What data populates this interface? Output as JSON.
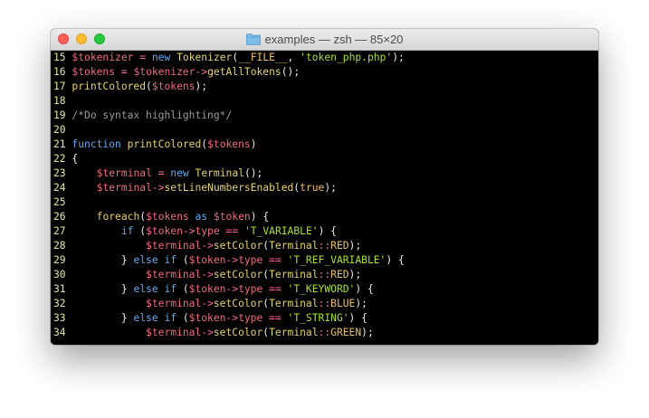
{
  "window": {
    "title": "examples — zsh — 85×20",
    "folder_icon": "folder-icon",
    "traffic_lights": [
      "close",
      "minimize",
      "maximize"
    ]
  },
  "colors": {
    "background": "#000000",
    "line_number": "#e6e6a0",
    "variable": "#f06a7c",
    "keyword": "#62a9f5",
    "function": "#e6d26e",
    "string": "#a6e22e",
    "comment": "#9a9a9a",
    "operator": "#ff6e9c",
    "plain": "#eaeaea",
    "constant": "#e8c06a"
  },
  "code_lines": [
    {
      "n": "15",
      "tokens": [
        [
          "var",
          "$tokenizer"
        ],
        [
          "p",
          " "
        ],
        [
          "op",
          "="
        ],
        [
          "p",
          " "
        ],
        [
          "kw",
          "new"
        ],
        [
          "p",
          " "
        ],
        [
          "fn",
          "Tokenizer"
        ],
        [
          "p",
          "("
        ],
        [
          "const",
          "__FILE__"
        ],
        [
          "p",
          ", "
        ],
        [
          "str",
          "'token_php.php'"
        ],
        [
          "p",
          ");"
        ]
      ]
    },
    {
      "n": "16",
      "tokens": [
        [
          "var",
          "$tokens"
        ],
        [
          "p",
          " "
        ],
        [
          "op",
          "="
        ],
        [
          "p",
          " "
        ],
        [
          "var",
          "$tokenizer"
        ],
        [
          "op",
          "->"
        ],
        [
          "fn",
          "getAllTokens"
        ],
        [
          "p",
          "();"
        ]
      ]
    },
    {
      "n": "17",
      "tokens": [
        [
          "fn",
          "printColored"
        ],
        [
          "p",
          "("
        ],
        [
          "var",
          "$tokens"
        ],
        [
          "p",
          ");"
        ]
      ]
    },
    {
      "n": "18",
      "tokens": []
    },
    {
      "n": "19",
      "tokens": [
        [
          "com",
          "/*Do syntax highlighting*/"
        ]
      ]
    },
    {
      "n": "20",
      "tokens": []
    },
    {
      "n": "21",
      "tokens": [
        [
          "kw",
          "function"
        ],
        [
          "p",
          " "
        ],
        [
          "fn",
          "printColored"
        ],
        [
          "p",
          "("
        ],
        [
          "var",
          "$tokens"
        ],
        [
          "p",
          ")"
        ]
      ]
    },
    {
      "n": "22",
      "tokens": [
        [
          "p",
          "{"
        ]
      ]
    },
    {
      "n": "23",
      "tokens": [
        [
          "p",
          "    "
        ],
        [
          "var",
          "$terminal"
        ],
        [
          "p",
          " "
        ],
        [
          "op",
          "="
        ],
        [
          "p",
          " "
        ],
        [
          "kw",
          "new"
        ],
        [
          "p",
          " "
        ],
        [
          "fn",
          "Terminal"
        ],
        [
          "p",
          "();"
        ]
      ]
    },
    {
      "n": "24",
      "tokens": [
        [
          "p",
          "    "
        ],
        [
          "var",
          "$terminal"
        ],
        [
          "op",
          "->"
        ],
        [
          "fn",
          "setLineNumbersEnabled"
        ],
        [
          "p",
          "("
        ],
        [
          "const",
          "true"
        ],
        [
          "p",
          ");"
        ]
      ]
    },
    {
      "n": "25",
      "tokens": []
    },
    {
      "n": "26",
      "tokens": [
        [
          "p",
          "    "
        ],
        [
          "fn",
          "foreach"
        ],
        [
          "p",
          "("
        ],
        [
          "var",
          "$tokens"
        ],
        [
          "p",
          " "
        ],
        [
          "kw",
          "as"
        ],
        [
          "p",
          " "
        ],
        [
          "var",
          "$token"
        ],
        [
          "p",
          ") {"
        ]
      ]
    },
    {
      "n": "27",
      "tokens": [
        [
          "p",
          "        "
        ],
        [
          "kw",
          "if"
        ],
        [
          "p",
          " ("
        ],
        [
          "var",
          "$token"
        ],
        [
          "op",
          "->"
        ],
        [
          "var",
          "type"
        ],
        [
          "p",
          " "
        ],
        [
          "op",
          "=="
        ],
        [
          "p",
          " "
        ],
        [
          "str",
          "'T_VARIABLE'"
        ],
        [
          "p",
          ") {"
        ]
      ]
    },
    {
      "n": "28",
      "tokens": [
        [
          "p",
          "            "
        ],
        [
          "var",
          "$terminal"
        ],
        [
          "op",
          "->"
        ],
        [
          "fn",
          "setColor"
        ],
        [
          "p",
          "("
        ],
        [
          "fn",
          "Terminal"
        ],
        [
          "op",
          "::"
        ],
        [
          "const",
          "RED"
        ],
        [
          "p",
          ");"
        ]
      ]
    },
    {
      "n": "29",
      "tokens": [
        [
          "p",
          "        } "
        ],
        [
          "kw",
          "else if"
        ],
        [
          "p",
          " ("
        ],
        [
          "var",
          "$token"
        ],
        [
          "op",
          "->"
        ],
        [
          "var",
          "type"
        ],
        [
          "p",
          " "
        ],
        [
          "op",
          "=="
        ],
        [
          "p",
          " "
        ],
        [
          "str",
          "'T_REF_VARIABLE'"
        ],
        [
          "p",
          ") {"
        ]
      ]
    },
    {
      "n": "30",
      "tokens": [
        [
          "p",
          "            "
        ],
        [
          "var",
          "$terminal"
        ],
        [
          "op",
          "->"
        ],
        [
          "fn",
          "setColor"
        ],
        [
          "p",
          "("
        ],
        [
          "fn",
          "Terminal"
        ],
        [
          "op",
          "::"
        ],
        [
          "const",
          "RED"
        ],
        [
          "p",
          ");"
        ]
      ]
    },
    {
      "n": "31",
      "tokens": [
        [
          "p",
          "        } "
        ],
        [
          "kw",
          "else if"
        ],
        [
          "p",
          " ("
        ],
        [
          "var",
          "$token"
        ],
        [
          "op",
          "->"
        ],
        [
          "var",
          "type"
        ],
        [
          "p",
          " "
        ],
        [
          "op",
          "=="
        ],
        [
          "p",
          " "
        ],
        [
          "str",
          "'T_KEYWORD'"
        ],
        [
          "p",
          ") {"
        ]
      ]
    },
    {
      "n": "32",
      "tokens": [
        [
          "p",
          "            "
        ],
        [
          "var",
          "$terminal"
        ],
        [
          "op",
          "->"
        ],
        [
          "fn",
          "setColor"
        ],
        [
          "p",
          "("
        ],
        [
          "fn",
          "Terminal"
        ],
        [
          "op",
          "::"
        ],
        [
          "const",
          "BLUE"
        ],
        [
          "p",
          ");"
        ]
      ]
    },
    {
      "n": "33",
      "tokens": [
        [
          "p",
          "        } "
        ],
        [
          "kw",
          "else if"
        ],
        [
          "p",
          " ("
        ],
        [
          "var",
          "$token"
        ],
        [
          "op",
          "->"
        ],
        [
          "var",
          "type"
        ],
        [
          "p",
          " "
        ],
        [
          "op",
          "=="
        ],
        [
          "p",
          " "
        ],
        [
          "str",
          "'T_STRING'"
        ],
        [
          "p",
          ") {"
        ]
      ]
    },
    {
      "n": "34",
      "tokens": [
        [
          "p",
          "            "
        ],
        [
          "var",
          "$terminal"
        ],
        [
          "op",
          "->"
        ],
        [
          "fn",
          "setColor"
        ],
        [
          "p",
          "("
        ],
        [
          "fn",
          "Terminal"
        ],
        [
          "op",
          "::"
        ],
        [
          "const",
          "GREEN"
        ],
        [
          "p",
          ");"
        ]
      ]
    }
  ]
}
